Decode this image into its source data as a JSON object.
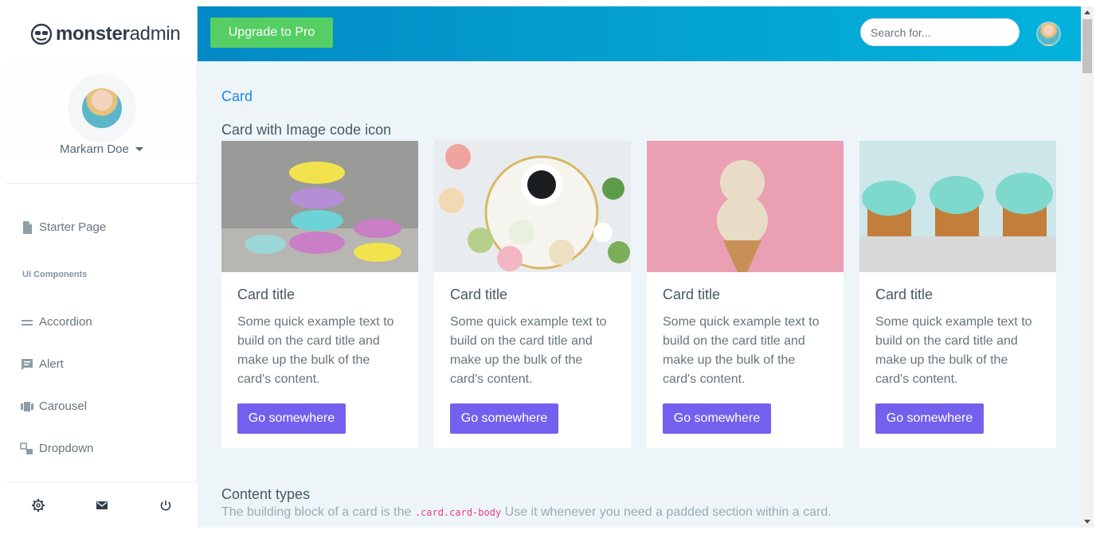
{
  "brand": {
    "name_bold": "monster",
    "name_light": "admin"
  },
  "topbar": {
    "upgrade_label": "Upgrade to Pro",
    "search_placeholder": "Search for..."
  },
  "profile": {
    "name": "Markarn Doe"
  },
  "sidebar": {
    "items": [
      {
        "label": "Starter Page",
        "icon": "file-icon"
      }
    ],
    "section_label": "UI Components",
    "components": [
      {
        "label": "Accordion",
        "icon": "equals-icon"
      },
      {
        "label": "Alert",
        "icon": "message-alert-icon"
      },
      {
        "label": "Carousel",
        "icon": "carousel-icon"
      },
      {
        "label": "Dropdown",
        "icon": "dropdown-icon"
      }
    ],
    "footer_icons": [
      "gear-icon",
      "mail-icon",
      "power-icon"
    ]
  },
  "main": {
    "breadcrumb": "Card",
    "section_title": "Card with Image code icon",
    "cards": [
      {
        "title": "Card title",
        "text": "Some quick example text to build on the card title and make up the bulk of the card's content.",
        "button": "Go somewhere",
        "image": "macarons-stack"
      },
      {
        "title": "Card title",
        "text": "Some quick example text to build on the card title and make up the bulk of the card's content.",
        "button": "Go somewhere",
        "image": "coffee-macarons"
      },
      {
        "title": "Card title",
        "text": "Some quick example text to build on the card title and make up the bulk of the card's content.",
        "button": "Go somewhere",
        "image": "ice-cream-cone"
      },
      {
        "title": "Card title",
        "text": "Some quick example text to build on the card title and make up the bulk of the card's content.",
        "button": "Go somewhere",
        "image": "cupcakes"
      }
    ],
    "content_types_title": "Content types",
    "content_types_desc_pre": "The building block of a card is the ",
    "content_types_code": ".card.card-body",
    "content_types_desc_post": " Use it whenever you need a padded section within a card."
  },
  "colors": {
    "accent_blue": "#1e88e5",
    "upgrade_green": "#55ce63",
    "button_purple": "#7460ee",
    "topbar_start": "#0389c6",
    "topbar_end": "#03b3dd"
  }
}
